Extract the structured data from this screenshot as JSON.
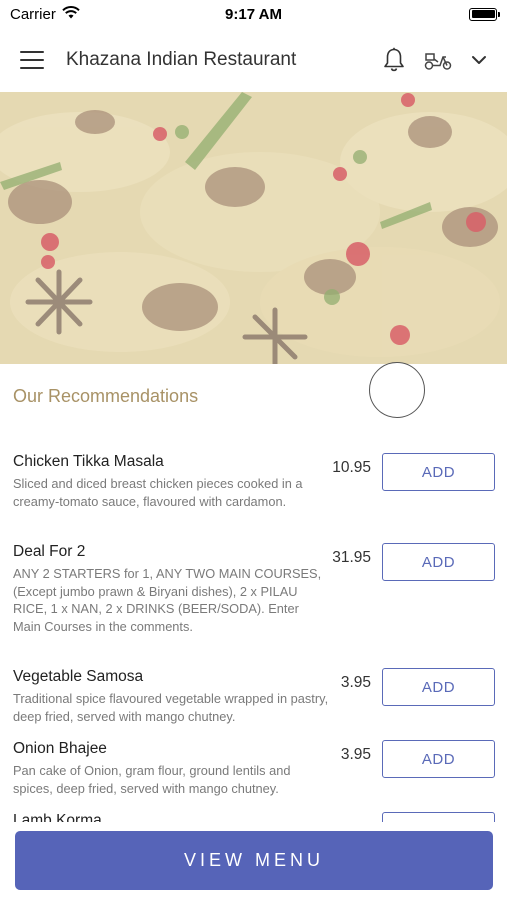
{
  "status_bar": {
    "carrier": "Carrier",
    "time": "9:17 AM"
  },
  "header": {
    "title": "Khazana Indian Restaurant",
    "icons": [
      "hamburger-menu-icon",
      "bell-icon",
      "scooter-icon",
      "chevron-down-icon"
    ]
  },
  "hero": {
    "image": "biryani-rice-dish-photo"
  },
  "recommendations": {
    "title": "Our Recommendations",
    "add_label": "ADD",
    "items": [
      {
        "name": "Chicken Tikka Masala",
        "description": "Sliced and diced breast chicken pieces cooked in a creamy-tomato sauce, flavoured with cardamon.",
        "price": "10.95"
      },
      {
        "name": "Deal For 2",
        "description": "ANY 2 STARTERS for 1, ANY TWO MAIN COURSES, (Except jumbo prawn & Biryani dishes), 2 x PILAU RICE, 1 x NAN, 2 x DRINKS (BEER/SODA). Enter Main Courses in the comments.",
        "price": "31.95"
      },
      {
        "name": "Vegetable Samosa",
        "description": "Traditional spice flavoured vegetable wrapped in pastry, deep fried, served with mango chutney.",
        "price": "3.95"
      },
      {
        "name": "Onion Bhajee",
        "description": "Pan cake of Onion, gram flour, ground lentils and spices, deep fried, served with mango chutney.",
        "price": "3.95"
      },
      {
        "name": "Lamb Korma",
        "description": "",
        "price": ""
      }
    ]
  },
  "footer": {
    "view_menu_label": "VIEW MENU"
  },
  "colors": {
    "accent": "#5664b8",
    "section_title": "#a89266"
  }
}
